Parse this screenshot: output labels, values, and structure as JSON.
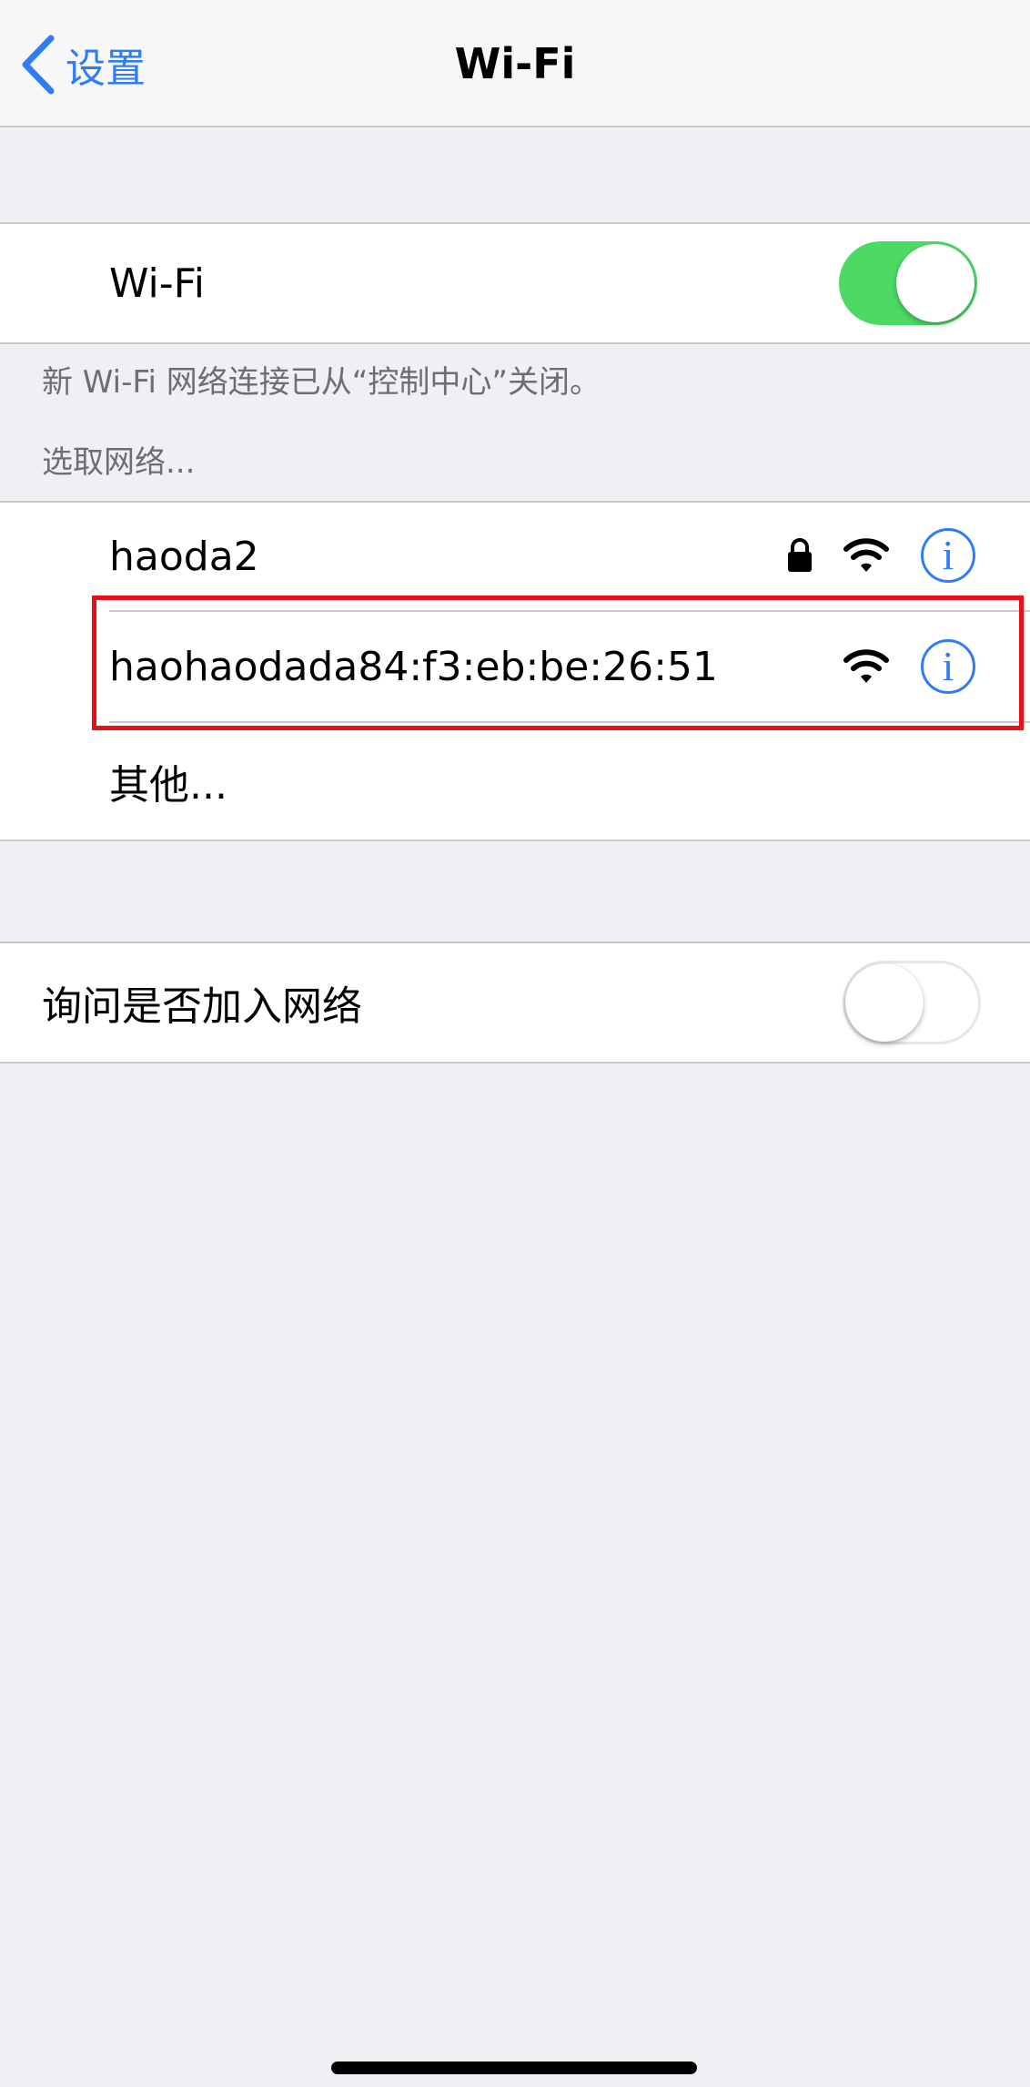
{
  "nav": {
    "back_label": "设置",
    "title": "Wi-Fi"
  },
  "wifi_toggle": {
    "label": "Wi-Fi",
    "state": "on",
    "on_color": "#4cd964"
  },
  "notes": {
    "control_center": "新 Wi-Fi 网络连接已从“控制中心”关闭。",
    "choose_network": "选取网络..."
  },
  "networks": [
    {
      "name": "haoda2",
      "secured": true,
      "icons": [
        "lock-icon",
        "wifi-icon",
        "info-icon"
      ]
    },
    {
      "name": "haohaodada84:f3:eb:be:26:51",
      "secured": false,
      "icons": [
        "wifi-icon",
        "info-icon"
      ],
      "highlighted": true
    }
  ],
  "other_label": "其他...",
  "ask_join": {
    "label": "询问是否加入网络",
    "state": "off"
  },
  "colors": {
    "accent": "#2f7cf6",
    "highlight": "#e8101b",
    "background": "#efeff4"
  }
}
